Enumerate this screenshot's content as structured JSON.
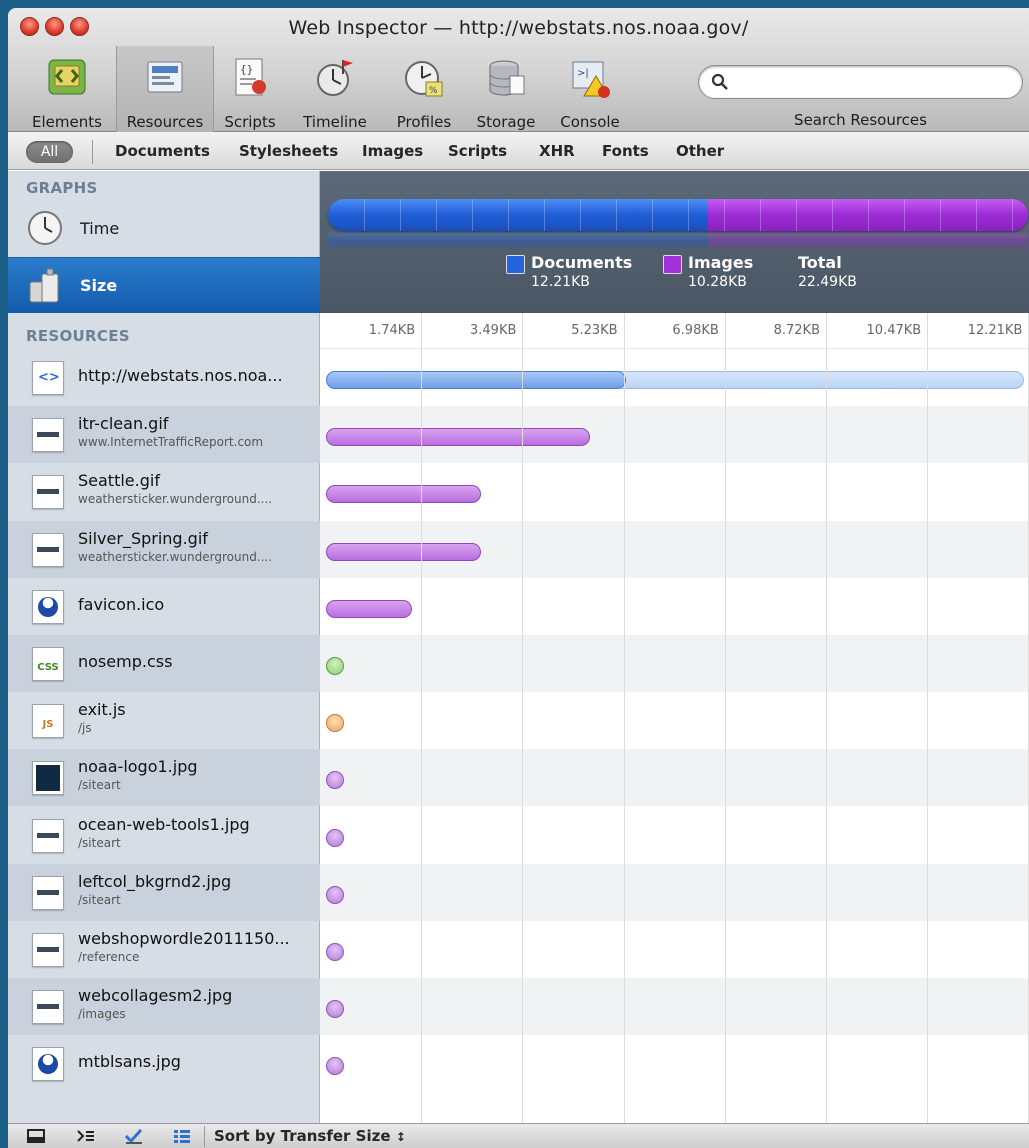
{
  "window": {
    "title": "Web Inspector — http://webstats.nos.noaa.gov/"
  },
  "toolbar": {
    "items": [
      {
        "label": "Elements",
        "icon": "elements-icon"
      },
      {
        "label": "Resources",
        "icon": "resources-icon",
        "active": true
      },
      {
        "label": "Scripts",
        "icon": "scripts-icon"
      },
      {
        "label": "Timeline",
        "icon": "timeline-icon"
      },
      {
        "label": "Profiles",
        "icon": "profiles-icon"
      },
      {
        "label": "Storage",
        "icon": "storage-icon"
      },
      {
        "label": "Console",
        "icon": "console-icon"
      }
    ],
    "search_label": "Search Resources",
    "search_value": ""
  },
  "filters": {
    "all": "All",
    "items": [
      "Documents",
      "Stylesheets",
      "Images",
      "Scripts",
      "XHR",
      "Fonts",
      "Other"
    ]
  },
  "sidebar": {
    "graphs_header": "GRAPHS",
    "graphs": [
      {
        "label": "Time",
        "icon": "clock-icon"
      },
      {
        "label": "Size",
        "icon": "weights-icon",
        "selected": true
      }
    ],
    "resources_header": "RESOURCES"
  },
  "summary": {
    "documents_label": "Documents",
    "documents_value": "12.21KB",
    "images_label": "Images",
    "images_value": "10.28KB",
    "total_label": "Total",
    "total_value": "22.49KB",
    "documents_fraction": 0.543,
    "colors": {
      "documents": "#2463d9",
      "images": "#a030d8"
    }
  },
  "scale": [
    "1.74KB",
    "3.49KB",
    "5.23KB",
    "6.98KB",
    "8.72KB",
    "10.47KB",
    "12.21KB"
  ],
  "resources": [
    {
      "name": "http://webstats.nos.noa...",
      "sub": "",
      "icon": "html-document-icon",
      "type": "doc",
      "transfer_kb": 5.23,
      "size_kb": 12.21
    },
    {
      "name": "itr-clean.gif",
      "sub": "www.InternetTrafficReport.com",
      "icon": "gif-image-icon",
      "type": "img",
      "size_kb": 4.6
    },
    {
      "name": "Seattle.gif",
      "sub": "weathersticker.wunderground....",
      "icon": "gif-image-icon",
      "type": "img",
      "size_kb": 2.7
    },
    {
      "name": "Silver_Spring.gif",
      "sub": "weathersticker.wunderground....",
      "icon": "gif-image-icon",
      "type": "img",
      "size_kb": 2.7
    },
    {
      "name": "favicon.ico",
      "sub": "",
      "icon": "noaa-favicon-icon",
      "type": "img",
      "size_kb": 1.5
    },
    {
      "name": "nosemp.css",
      "sub": "",
      "icon": "css-file-icon",
      "type": "css",
      "size_kb": 0
    },
    {
      "name": "exit.js",
      "sub": "/js",
      "icon": "js-file-icon",
      "type": "js",
      "size_kb": 0
    },
    {
      "name": "noaa-logo1.jpg",
      "sub": "/siteart",
      "icon": "noaa-logo-thumb-icon",
      "type": "img",
      "size_kb": 0
    },
    {
      "name": "ocean-web-tools1.jpg",
      "sub": "/siteart",
      "icon": "jpg-image-icon",
      "type": "img",
      "size_kb": 0
    },
    {
      "name": "leftcol_bkgrnd2.jpg",
      "sub": "/siteart",
      "icon": "jpg-image-icon",
      "type": "img",
      "size_kb": 0
    },
    {
      "name": "webshopwordle2011150...",
      "sub": "/reference",
      "icon": "jpg-image-icon",
      "type": "img",
      "size_kb": 0
    },
    {
      "name": "webcollagesm2.jpg",
      "sub": "/images",
      "icon": "jpg-image-icon",
      "type": "img",
      "size_kb": 0
    },
    {
      "name": "mtblsans.jpg",
      "sub": "",
      "icon": "noaa-favicon-icon",
      "type": "img",
      "size_kb": 0
    }
  ],
  "statusbar": {
    "sort_label": "Sort by Transfer Size",
    "buttons": [
      "dock-icon",
      "console-prompt-icon",
      "check-icon",
      "list-icon"
    ]
  }
}
